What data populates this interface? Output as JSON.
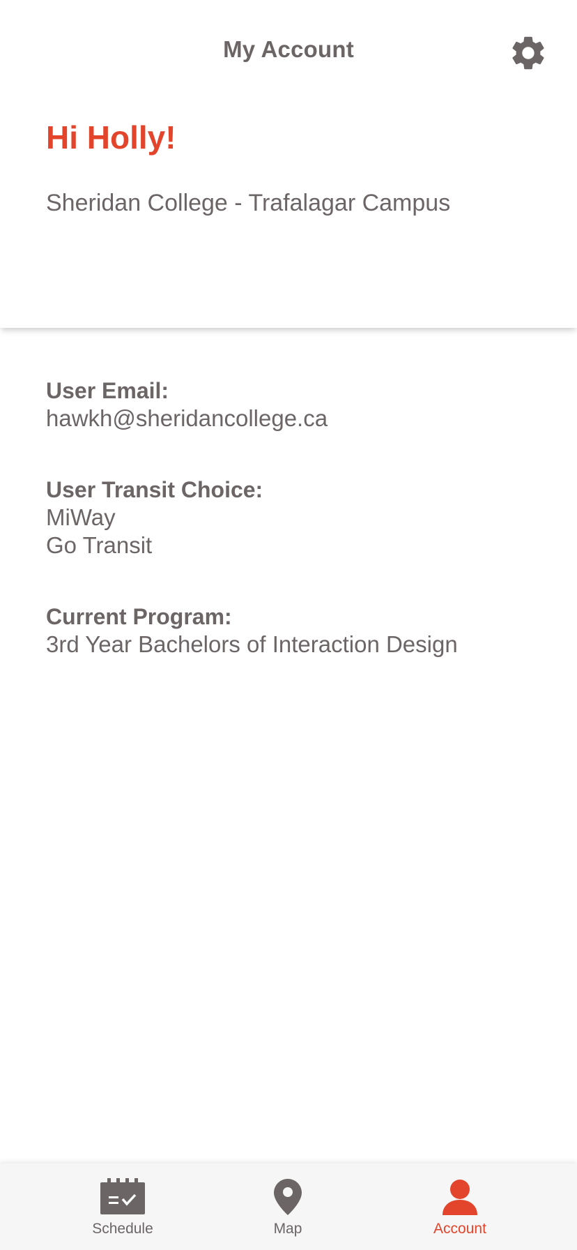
{
  "colors": {
    "accent": "#e2452b",
    "text": "#6b6566",
    "nav_background": "#f6f6f6"
  },
  "header": {
    "title": "My Account",
    "settings_icon": "gear-icon"
  },
  "profile": {
    "greeting": "Hi Holly!",
    "campus": "Sheridan College - Trafalagar Campus"
  },
  "details": {
    "email_label": "User Email:",
    "email_value": "hawkh@sheridancollege.ca",
    "transit_label": "User Transit Choice:",
    "transit_values": [
      "MiWay",
      "Go Transit"
    ],
    "program_label": "Current Program:",
    "program_value": "3rd Year Bachelors of Interaction Design"
  },
  "nav": {
    "items": [
      {
        "label": "Schedule",
        "icon": "calendar-check-icon",
        "active": false
      },
      {
        "label": "Map",
        "icon": "map-pin-icon",
        "active": false
      },
      {
        "label": "Account",
        "icon": "person-icon",
        "active": true
      }
    ]
  }
}
